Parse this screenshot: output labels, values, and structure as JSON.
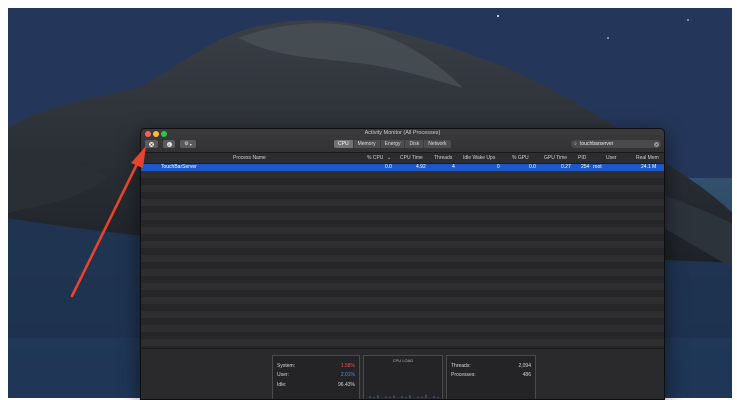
{
  "window": {
    "title": "Activity Monitor (All Processes)"
  },
  "toolbar": {
    "stop_icon": "x-circle-icon",
    "info_icon": "info-icon",
    "gear_icon": "gear-icon",
    "tabs": [
      {
        "label": "CPU",
        "active": true
      },
      {
        "label": "Memory",
        "active": false
      },
      {
        "label": "Energy",
        "active": false
      },
      {
        "label": "Disk",
        "active": false
      },
      {
        "label": "Network",
        "active": false
      }
    ],
    "search_value": "touchbarserver"
  },
  "table": {
    "columns": [
      "Process Name",
      "% CPU",
      "CPU Time",
      "Threads",
      "Idle Wake Ups",
      "% GPU",
      "GPU Time",
      "PID",
      "User",
      "Real Mem"
    ],
    "rows": [
      {
        "process_name": "TouchBarServer",
        "cpu": "0.0",
        "cpu_time": "4.92",
        "threads": "4",
        "idle_wake_ups": "0",
        "gpu": "0.0",
        "gpu_time": "0.27",
        "pid": "254",
        "user": "root",
        "real_mem": "24.1 M"
      }
    ]
  },
  "summary": {
    "system_label": "System:",
    "system_value": "1.58%",
    "user_label": "User:",
    "user_value": "2.01%",
    "idle_label": "Idle:",
    "idle_value": "96.43%",
    "cpu_load_label": "CPU LOAD",
    "threads_label": "Threads:",
    "threads_value": "2,094",
    "processes_label": "Processes:",
    "processes_value": "486"
  },
  "colors": {
    "selection": "#1c58c9",
    "system": "#ff4a4a",
    "user": "#3d8fff",
    "arrow": "#e8432e"
  }
}
